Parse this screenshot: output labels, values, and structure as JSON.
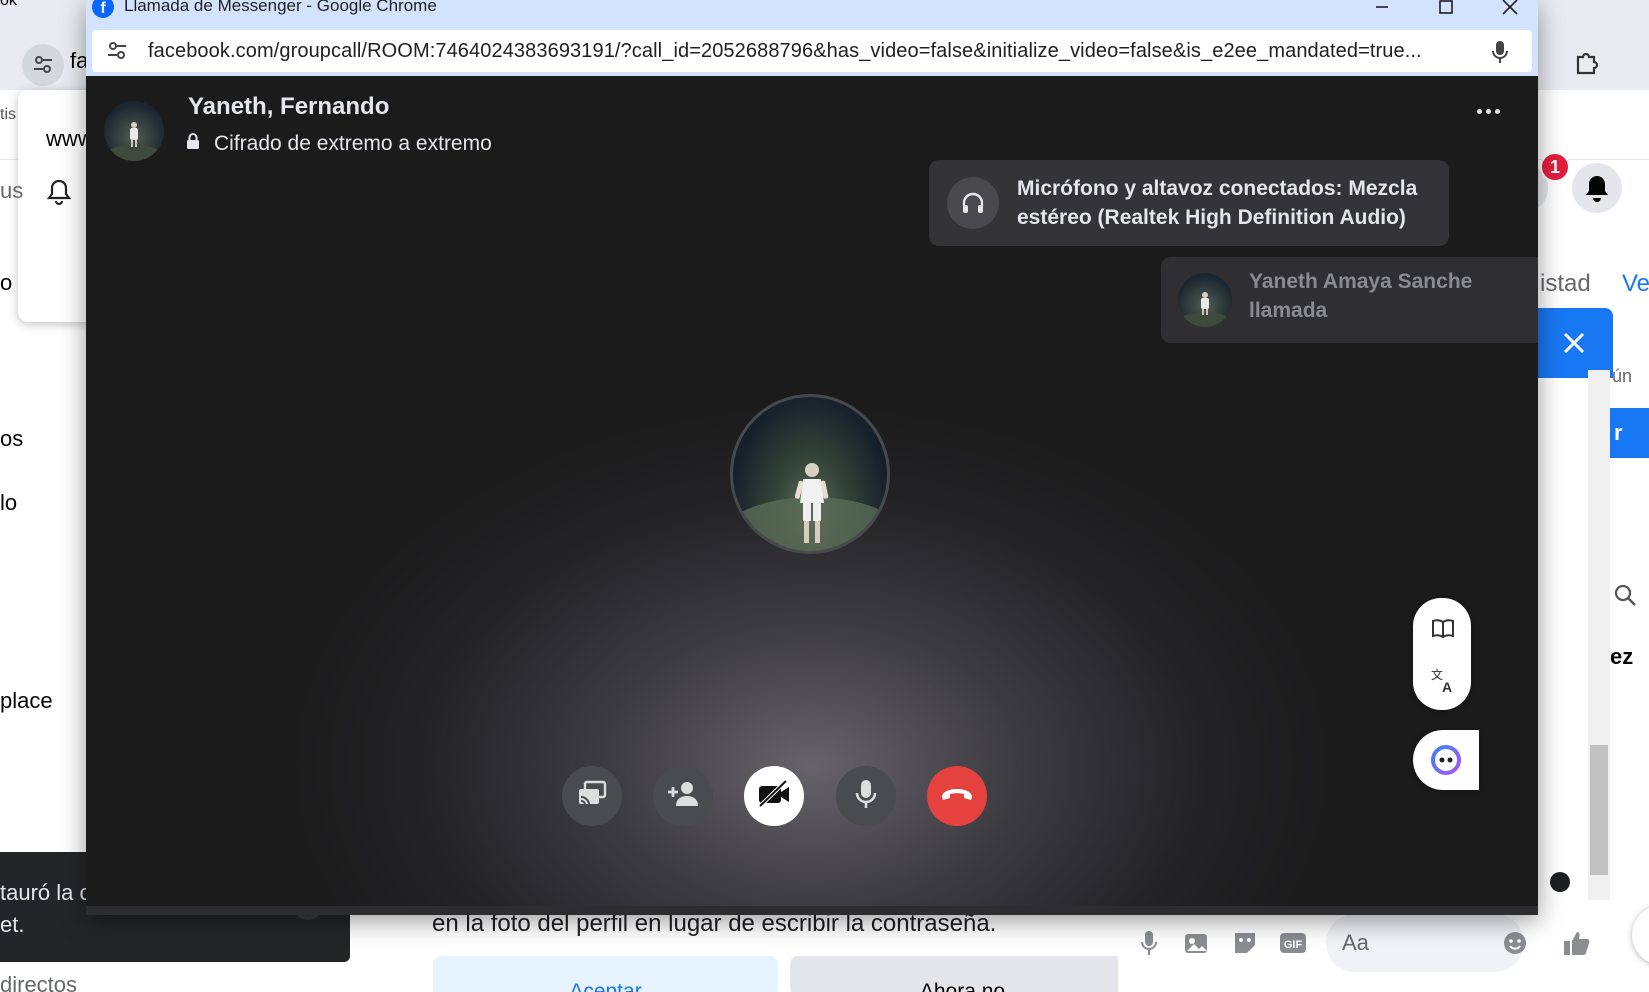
{
  "background": {
    "partial_texts": [
      {
        "id": "ok",
        "text": "ok"
      },
      {
        "id": "fa",
        "text": "fa"
      },
      {
        "id": "tis",
        "text": "tis"
      },
      {
        "id": "www",
        "text": "www"
      },
      {
        "id": "us",
        "text": "us"
      },
      {
        "id": "o",
        "text": "o"
      },
      {
        "id": "os",
        "text": "os"
      },
      {
        "id": "lo",
        "text": "lo"
      },
      {
        "id": "place",
        "text": "place"
      },
      {
        "id": "istad",
        "text": "istad"
      },
      {
        "id": "ver",
        "text": "Ver"
      },
      {
        "id": "un",
        "text": "ún"
      },
      {
        "id": "ez",
        "text": "ez"
      },
      {
        "id": "r",
        "text": "r"
      }
    ],
    "notification_badge": "1",
    "toast_lines": [
      "tauró la c",
      "et."
    ],
    "bottom_left_text": "directos",
    "profile_prompt_text": "en la foto del perfil en lugar de escribir la contraseña.",
    "accept_label": "Aceptar",
    "not_now_label": "Ahora no",
    "composer_placeholder": "Aa",
    "accent_color": "#1877f2",
    "badge_color": "#e41e3f"
  },
  "window": {
    "title": "Llamada de Messenger - Google Chrome",
    "url": "facebook.com/groupcall/ROOM:7464024383693191/?call_id=2052688796&has_video=false&initialize_video=false&is_e2ee_mandated=true..."
  },
  "call": {
    "participants_title": "Yaneth, Fernando",
    "encryption_label": "Cifrado de extremo a extremo",
    "audio_toast": "Micrófono y altavoz conectados: Mezcla estéreo (Realtek High Definition Audio)",
    "incoming_toast_name": "Yaneth Amaya Sanche",
    "incoming_toast_sub": "llamada",
    "controls": [
      {
        "name": "share-screen",
        "icon": "screen-share-icon"
      },
      {
        "name": "add-person",
        "icon": "add-person-icon"
      },
      {
        "name": "camera-toggle",
        "icon": "video-off-icon"
      },
      {
        "name": "microphone",
        "icon": "microphone-icon"
      },
      {
        "name": "end-call",
        "icon": "hang-up-icon"
      }
    ],
    "end_call_color": "#e5413e"
  }
}
